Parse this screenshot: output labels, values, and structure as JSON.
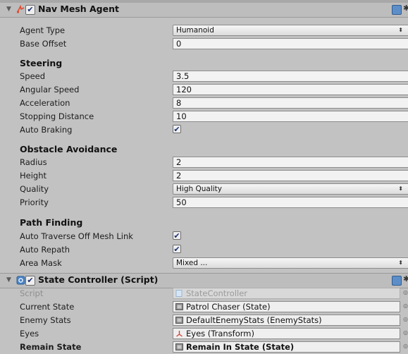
{
  "nav_mesh_agent": {
    "title": "Nav Mesh Agent",
    "enabled_glyph": "✔",
    "fold_glyph": "▼",
    "agent_type": {
      "label": "Agent Type",
      "value": "Humanoid"
    },
    "base_offset": {
      "label": "Base Offset",
      "value": "0"
    },
    "steering": {
      "heading": "Steering",
      "speed": {
        "label": "Speed",
        "value": "3.5"
      },
      "angular_speed": {
        "label": "Angular Speed",
        "value": "120"
      },
      "acceleration": {
        "label": "Acceleration",
        "value": "8"
      },
      "stopping_distance": {
        "label": "Stopping Distance",
        "value": "10"
      },
      "auto_braking": {
        "label": "Auto Braking",
        "checked": "✔"
      }
    },
    "obstacle_avoidance": {
      "heading": "Obstacle Avoidance",
      "radius": {
        "label": "Radius",
        "value": "2"
      },
      "height": {
        "label": "Height",
        "value": "2"
      },
      "quality": {
        "label": "Quality",
        "value": "High Quality"
      },
      "priority": {
        "label": "Priority",
        "value": "50"
      }
    },
    "path_finding": {
      "heading": "Path Finding",
      "auto_traverse": {
        "label": "Auto Traverse Off Mesh Link",
        "checked": "✔"
      },
      "auto_repath": {
        "label": "Auto Repath",
        "checked": "✔"
      },
      "area_mask": {
        "label": "Area Mask",
        "value": "Mixed ..."
      }
    }
  },
  "state_controller": {
    "title": "State Controller (Script)",
    "enabled_glyph": "✔",
    "fold_glyph": "▼",
    "script": {
      "label": "Script",
      "value": "StateController"
    },
    "current_state": {
      "label": "Current State",
      "value": "Patrol Chaser (State)"
    },
    "enemy_stats": {
      "label": "Enemy Stats",
      "value": "DefaultEnemyStats (EnemyStats)"
    },
    "eyes": {
      "label": "Eyes",
      "value": "Eyes (Transform)"
    },
    "remain_state": {
      "label": "Remain State",
      "value": "Remain In State (State)"
    }
  },
  "glyphs": {
    "dropdown_arrow": "⬍",
    "gear": "✱",
    "picker": "◎"
  },
  "colors": {
    "checkmark": "#1d2f70",
    "book_icon": "#5e8ec7",
    "nav_icon": "#e04a2c",
    "script_icon": "#4b86c8"
  }
}
